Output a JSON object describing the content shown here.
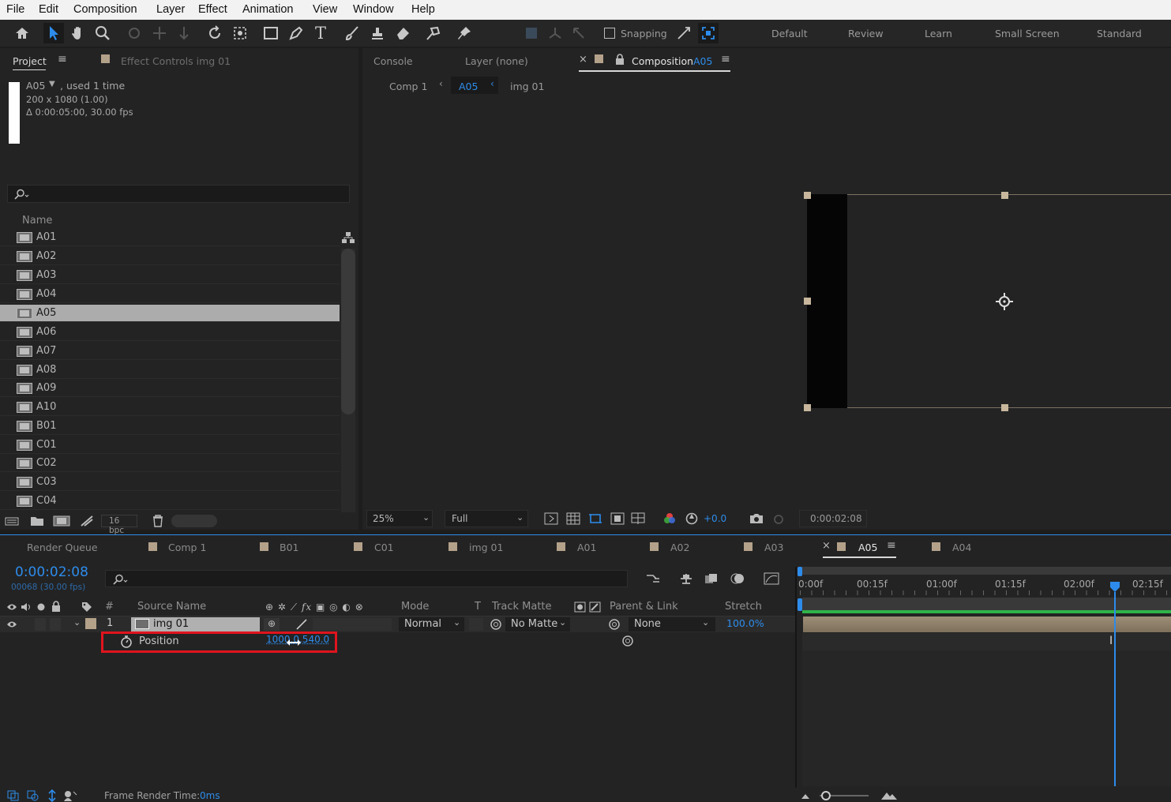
{
  "menu": [
    "File",
    "Edit",
    "Composition",
    "Layer",
    "Effect",
    "Animation",
    "View",
    "Window",
    "Help"
  ],
  "toolbar": {
    "snapping": "Snapping"
  },
  "workspaces": [
    "Default",
    "Review",
    "Learn",
    "Small Screen",
    "Standard"
  ],
  "project_panel": {
    "tab": "Project",
    "effect_controls_tab": "Effect Controls img 01",
    "info_name": "A05",
    "info_used": ", used 1 time",
    "info_size": "200 x 1080 (1.00)",
    "info_duration": "Δ 0:00:05:00, 30.00 fps",
    "name_header": "Name",
    "items": [
      "A01",
      "A02",
      "A03",
      "A04",
      "A05",
      "A06",
      "A07",
      "A08",
      "A09",
      "A10",
      "B01",
      "C01",
      "C02",
      "C03",
      "C04"
    ],
    "selected": "A05",
    "bpc": "16 bpc"
  },
  "viewer": {
    "tabs": {
      "console": "Console",
      "layer": "Layer (none)",
      "composition": "Composition",
      "comp_name": "A05"
    },
    "breadcrumb": [
      "Comp 1",
      "A05",
      "img 01"
    ],
    "zoom": "25%",
    "resolution": "Full",
    "exposure": "+0.0",
    "timecode": "0:00:02:08"
  },
  "timeline": {
    "tabs": [
      "Render Queue",
      "Comp 1",
      "B01",
      "C01",
      "img 01",
      "A01",
      "A02",
      "A03",
      "A05",
      "A04"
    ],
    "active_tab": "A05",
    "timecode": "0:00:02:08",
    "frame_info": "00068 (30.00 fps)",
    "columns": {
      "num": "#",
      "source": "Source Name",
      "mode": "Mode",
      "t": "T",
      "track_matte": "Track Matte",
      "parent": "Parent & Link",
      "stretch": "Stretch"
    },
    "layer": {
      "index": "1",
      "name": "img 01",
      "mode": "Normal",
      "matte": "No Matte",
      "parent": "None",
      "stretch": "100.0%"
    },
    "property": {
      "name": "Position",
      "value": "1000.0,540.0"
    },
    "ruler_labels": [
      "0:00f",
      "00:15f",
      "01:00f",
      "01:15f",
      "02:00f",
      "02:15f"
    ],
    "frame_render_label": "Frame Render Time:",
    "frame_render_value": "0ms"
  },
  "colors": {
    "accent": "#2d8ceb",
    "highlight_box": "#e0141e",
    "label_tan": "#b4a18a",
    "work_area_green": "#2fb24a"
  }
}
